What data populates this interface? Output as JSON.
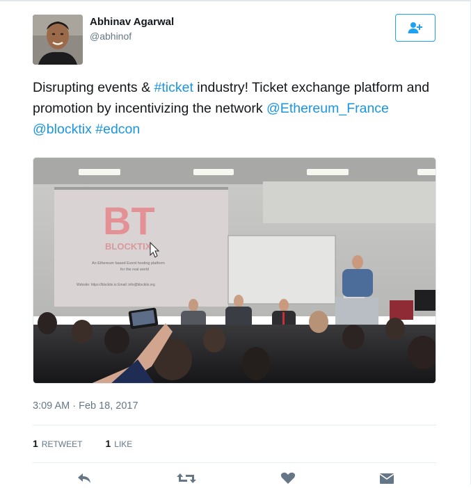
{
  "user": {
    "name": "Abhinav Agarwal",
    "handle": "@abhinof"
  },
  "follow_button": {
    "icon": "person-add-icon"
  },
  "tweet": {
    "text_1": "Disrupting events & ",
    "hashtag_ticket": "#ticket",
    "text_2": " industry! Ticket exchange platform and promotion by incentivizing the network ",
    "mention_ethereum": "@Ethereum_France",
    "mention_blocktix": "@blocktix",
    "hashtag_edcon": "#edcon"
  },
  "media": {
    "slide_logo": "BT",
    "slide_brand": "BLOCKTIX",
    "slide_line1": "An Ethereum based Event hosting platform",
    "slide_line2": "for the real world",
    "slide_footer": "Website: https://blocktix.io       Email: info@blocktix.org"
  },
  "meta": {
    "timestamp": "3:09 AM · Feb 18, 2017"
  },
  "stats": {
    "retweets_count": "1",
    "retweets_label": "RETWEET",
    "likes_count": "1",
    "likes_label": "LIKE"
  },
  "actions": [
    "reply-icon",
    "retweet-icon",
    "like-icon",
    "message-icon"
  ],
  "colors": {
    "link": "#1b95e0",
    "accent": "#1da1f2",
    "secondary_text": "#657786"
  }
}
